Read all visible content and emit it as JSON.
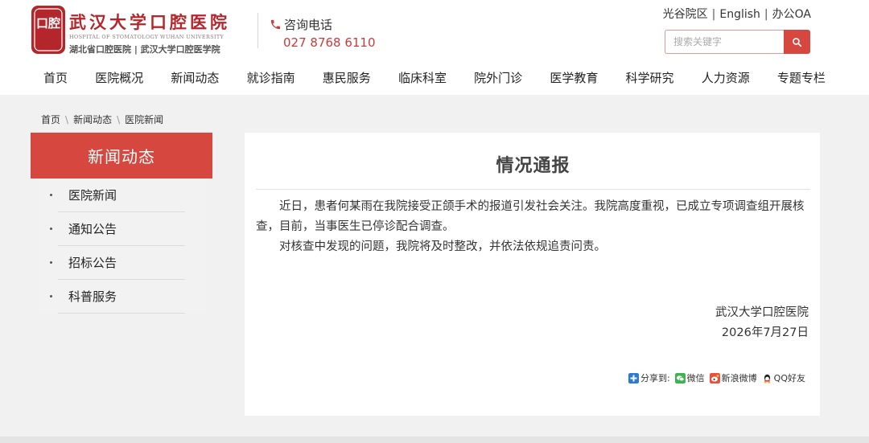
{
  "header": {
    "logo_cn": "武汉大学口腔医院",
    "logo_en": "HOSPITAL OF STOMATOLOGY WUHAN UNIVERSITY",
    "logo_sub": "湖北省口腔医院 | 武汉大学口腔医学院",
    "seal_text": "口腔",
    "hotline_label": "咨询电话",
    "hotline_number": "027 8768 6110",
    "top_links": [
      "光谷院区",
      "English",
      "办公OA"
    ],
    "search_placeholder": "搜索关键字"
  },
  "nav": {
    "items": [
      "首页",
      "医院概况",
      "新闻动态",
      "就诊指南",
      "惠民服务",
      "临床科室",
      "院外门诊",
      "医学教育",
      "科学研究",
      "人力资源",
      "专题专栏"
    ]
  },
  "breadcrumb": [
    "首页",
    "新闻动态",
    "医院新闻"
  ],
  "sidebar": {
    "title": "新闻动态",
    "items": [
      "医院新闻",
      "通知公告",
      "招标公告",
      "科普服务"
    ]
  },
  "article": {
    "title": "情况通报",
    "paragraphs": [
      "近日，患者何某雨在我院接受正颌手术的报道引发社会关注。我院高度重视，已成立专项调查组开展核查，目前，当事医生已停诊配合调查。",
      "对核查中发现的问题，我院将及时整改，并依法依规追责问责。"
    ],
    "signature": "武汉大学口腔医院",
    "date": "2026年7月27日"
  },
  "share": {
    "label": "分享到:",
    "targets": [
      "微信",
      "新浪微博",
      "QQ好友"
    ]
  },
  "colors": {
    "accent": "#d5473f",
    "brand": "#b3262b",
    "hotline": "#c83c3c"
  }
}
